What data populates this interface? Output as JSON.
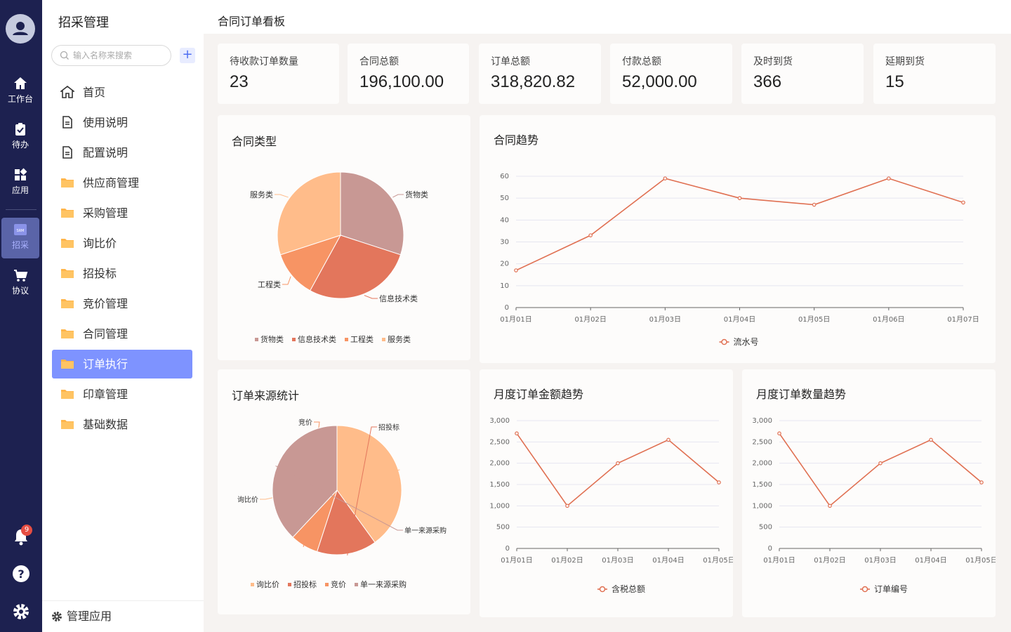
{
  "rail": {
    "items": [
      {
        "label": "工作台",
        "icon": "home-icon"
      },
      {
        "label": "待办",
        "icon": "clipboard-icon"
      },
      {
        "label": "应用",
        "icon": "apps-icon"
      },
      {
        "label": "招采",
        "icon": "srm-icon",
        "icon_text": "SRM"
      },
      {
        "label": "协议",
        "icon": "cart-icon"
      }
    ],
    "notification_count": "9"
  },
  "sidebar": {
    "title": "招采管理",
    "search_placeholder": "输入名称来搜索",
    "add_label": "+",
    "items": [
      {
        "label": "首页",
        "icon": "home-outline-icon"
      },
      {
        "label": "使用说明",
        "icon": "document-icon"
      },
      {
        "label": "配置说明",
        "icon": "document-icon"
      },
      {
        "label": "供应商管理",
        "icon": "folder-icon"
      },
      {
        "label": "采购管理",
        "icon": "folder-icon"
      },
      {
        "label": "询比价",
        "icon": "folder-icon"
      },
      {
        "label": "招投标",
        "icon": "folder-icon"
      },
      {
        "label": "竞价管理",
        "icon": "folder-icon"
      },
      {
        "label": "合同管理",
        "icon": "folder-icon"
      },
      {
        "label": "订单执行",
        "icon": "folder-icon",
        "active": true
      },
      {
        "label": "印章管理",
        "icon": "folder-icon"
      },
      {
        "label": "基础数据",
        "icon": "folder-icon"
      }
    ],
    "footer_label": "管理应用"
  },
  "page": {
    "title": "合同订单看板"
  },
  "stats": [
    {
      "label": "待收款订单数量",
      "value": "23"
    },
    {
      "label": "合同总额",
      "value": "196,100.00"
    },
    {
      "label": "订单总额",
      "value": "318,820.82"
    },
    {
      "label": "付款总额",
      "value": "52,000.00"
    },
    {
      "label": "及时到货",
      "value": "366"
    },
    {
      "label": "延期到货",
      "value": "15"
    }
  ],
  "colors": {
    "accent": "#7e93ff",
    "rail": "#1d2150",
    "line": "#e07052"
  },
  "chart_data": [
    {
      "type": "pie",
      "title": "合同类型",
      "slices": [
        {
          "name": "货物类",
          "value": 30,
          "color": "#c89894"
        },
        {
          "name": "信息技术类",
          "value": 28,
          "color": "#e3765c"
        },
        {
          "name": "工程类",
          "value": 12,
          "color": "#f79464"
        },
        {
          "name": "服务类",
          "value": 30,
          "color": "#ffbc8a"
        }
      ]
    },
    {
      "type": "line",
      "title": "合同趋势",
      "categories": [
        "01月01日",
        "01月02日",
        "01月03日",
        "01月04日",
        "01月05日",
        "01月06日",
        "01月07日"
      ],
      "series": [
        {
          "name": "流水号",
          "values": [
            17,
            33,
            59,
            50,
            47,
            59,
            48
          ]
        }
      ],
      "ylim": [
        0,
        60
      ],
      "yticks": [
        "0",
        "10",
        "20",
        "30",
        "40",
        "50",
        "60"
      ]
    },
    {
      "type": "pie",
      "title": "订单来源统计",
      "slices": [
        {
          "name": "询比价",
          "value": 40,
          "color": "#ffbc8a"
        },
        {
          "name": "招投标",
          "value": 15,
          "color": "#e3765c"
        },
        {
          "name": "竞价",
          "value": 7,
          "color": "#f79464"
        },
        {
          "name": "单一来源采购",
          "value": 38,
          "color": "#c89894"
        }
      ]
    },
    {
      "type": "line",
      "title": "月度订单金额趋势",
      "categories": [
        "01月01日",
        "01月02日",
        "01月03日",
        "01月04日",
        "01月05日"
      ],
      "series": [
        {
          "name": "含税总额",
          "values": [
            2700,
            1000,
            2000,
            2550,
            1550
          ]
        }
      ],
      "ylim": [
        0,
        3000
      ],
      "yticks": [
        "0",
        "500",
        "1,000",
        "1,500",
        "2,000",
        "2,500",
        "3,000"
      ]
    },
    {
      "type": "line",
      "title": "月度订单数量趋势",
      "categories": [
        "01月01日",
        "01月02日",
        "01月03日",
        "01月04日",
        "01月05日"
      ],
      "series": [
        {
          "name": "订单编号",
          "values": [
            2700,
            1000,
            2000,
            2550,
            1550
          ]
        }
      ],
      "ylim": [
        0,
        3000
      ],
      "yticks": [
        "0",
        "500",
        "1,000",
        "1,500",
        "2,000",
        "2,500",
        "3,000"
      ]
    }
  ]
}
